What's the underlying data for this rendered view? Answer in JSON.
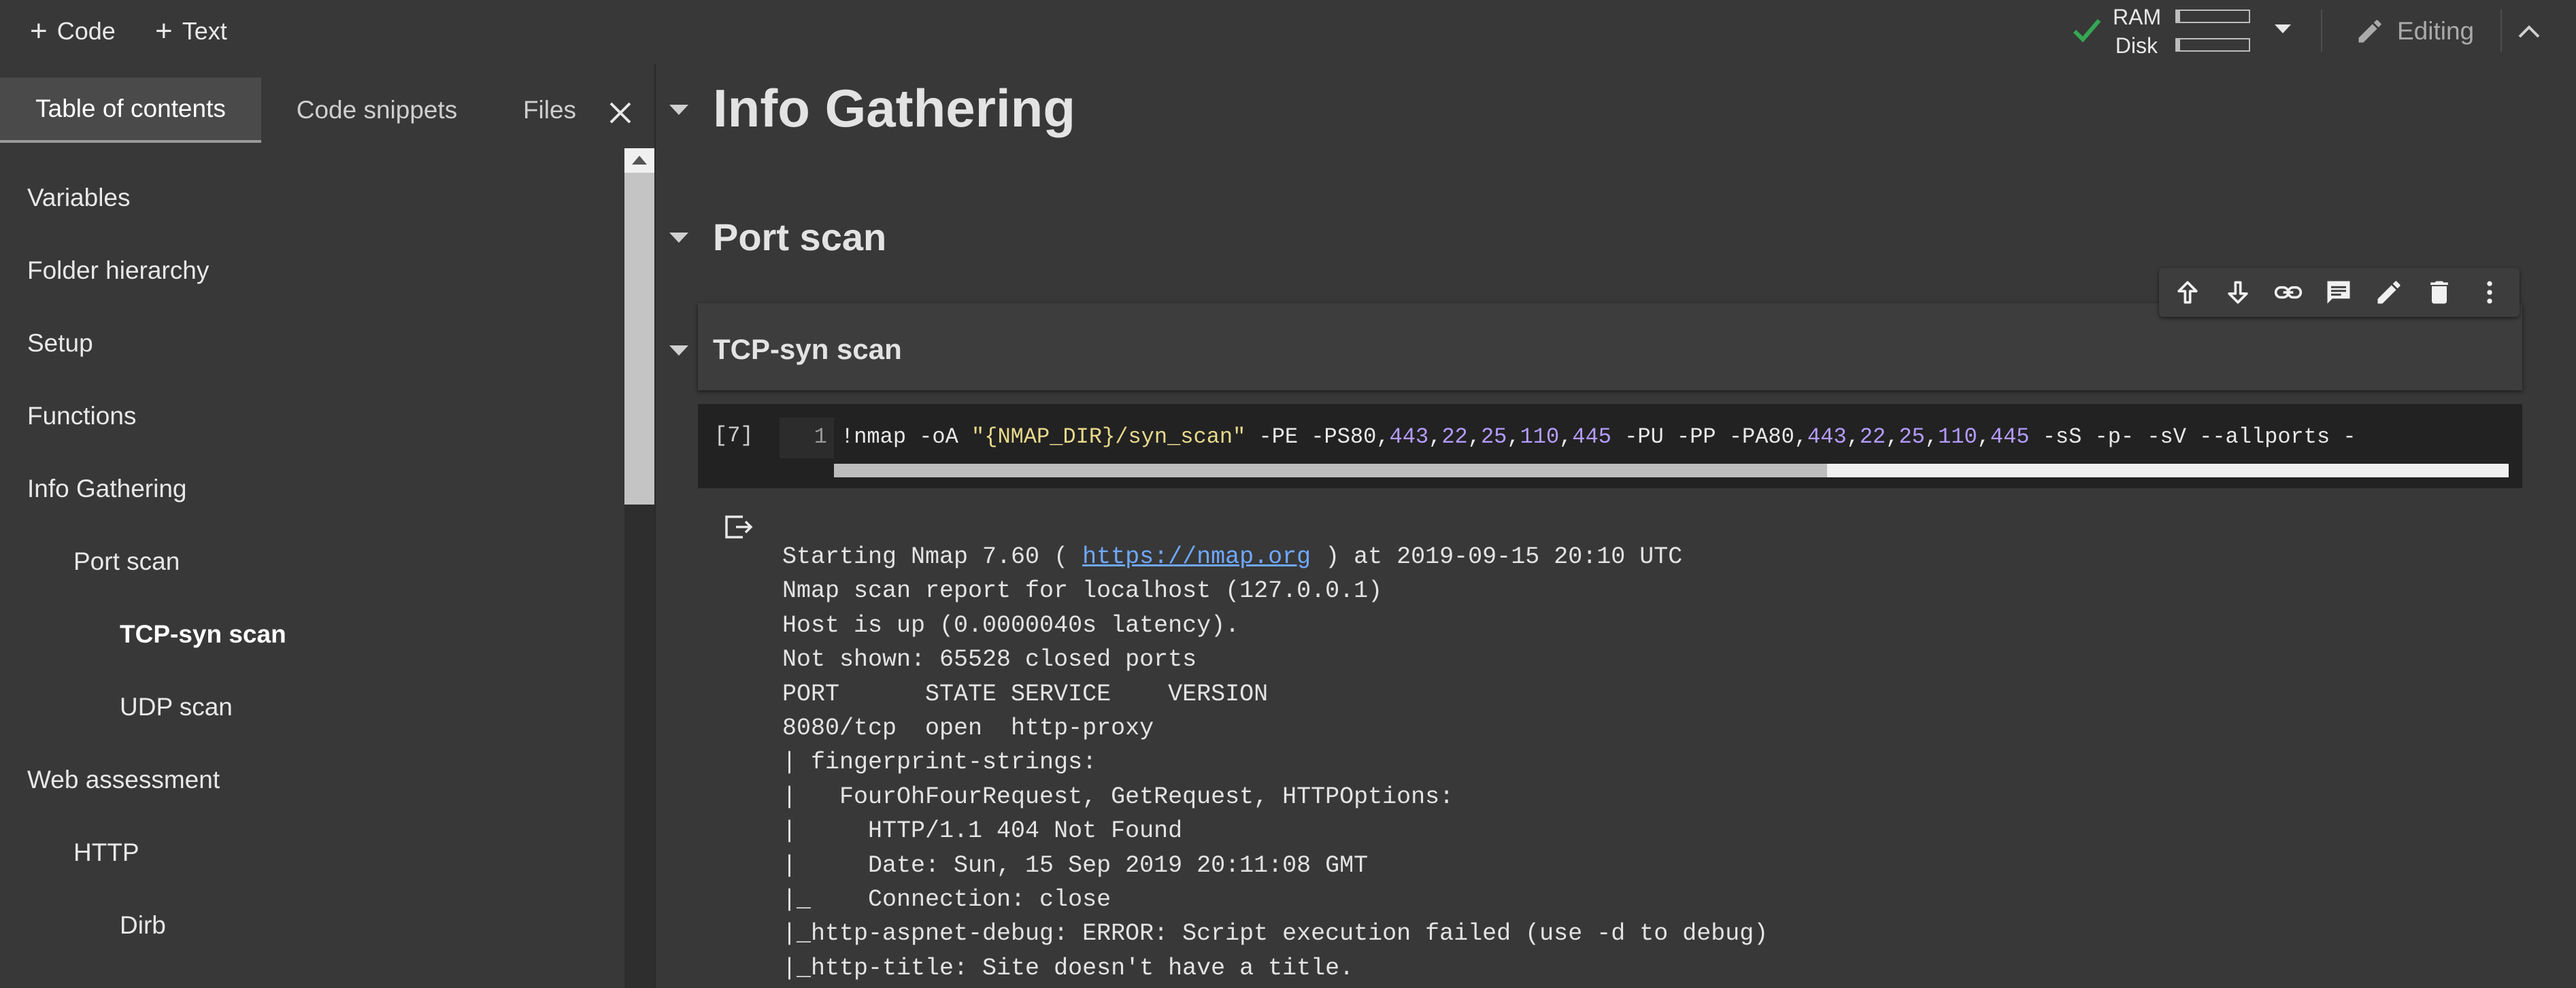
{
  "toolbar": {
    "add_code_label": "Code",
    "add_text_label": "Text",
    "ram_label": "RAM",
    "disk_label": "Disk",
    "ram_usage_fraction": 0.05,
    "disk_usage_fraction": 0.05,
    "editing_label": "Editing",
    "status_color": "#34a853"
  },
  "sidebar": {
    "tabs": [
      {
        "label": "Table of contents",
        "active": true
      },
      {
        "label": "Code snippets",
        "active": false
      },
      {
        "label": "Files",
        "active": false
      }
    ],
    "toc": [
      {
        "label": "Variables",
        "level": 0
      },
      {
        "label": "Folder hierarchy",
        "level": 0
      },
      {
        "label": "Setup",
        "level": 0
      },
      {
        "label": "Functions",
        "level": 0
      },
      {
        "label": "Info Gathering",
        "level": 0
      },
      {
        "label": "Port scan",
        "level": 1
      },
      {
        "label": "TCP-syn scan",
        "level": 2,
        "active": true
      },
      {
        "label": "UDP scan",
        "level": 2
      },
      {
        "label": "Web assessment",
        "level": 0
      },
      {
        "label": "HTTP",
        "level": 1
      },
      {
        "label": "Dirb",
        "level": 2
      }
    ]
  },
  "notebook": {
    "heading_info_gathering": "Info Gathering",
    "heading_port_scan": "Port scan",
    "heading_tcp_syn_scan": "TCP-syn scan",
    "cell_toolbar_icons": [
      "arrow-up-icon",
      "arrow-down-icon",
      "link-icon",
      "comment-icon",
      "edit-icon",
      "delete-icon",
      "more-vert-icon"
    ],
    "code_cell": {
      "exec_count": "[7]",
      "line_number": "1",
      "code_parts": {
        "p1": "!nmap -oA ",
        "s1": "\"{NMAP_DIR}/syn_scan\"",
        "p2": " -PE -PS80,",
        "n1": "443",
        "c1": ",",
        "n2": "22",
        "c2": ",",
        "n3": "25",
        "c3": ",",
        "n4": "110",
        "c4": ",",
        "n5": "445",
        "p3": " -PU -PP -PA80,",
        "n6": "443",
        "c5": ",",
        "n7": "22",
        "c6": ",",
        "n8": "25",
        "c7": ",",
        "n9": "110",
        "c8": ",",
        "n10": "445",
        "p4": " -sS -p- -sV --allports -"
      }
    },
    "output": {
      "line1_pre": "Starting Nmap 7.60 ( ",
      "line1_link": "https://nmap.org",
      "line1_post": " ) at 2019-09-15 20:10 UTC",
      "lines": [
        "Nmap scan report for localhost (127.0.0.1)",
        "Host is up (0.0000040s latency).",
        "Not shown: 65528 closed ports",
        "PORT      STATE SERVICE    VERSION",
        "8080/tcp  open  http-proxy",
        "| fingerprint-strings:",
        "|   FourOhFourRequest, GetRequest, HTTPOptions:",
        "|     HTTP/1.1 404 Not Found",
        "|     Date: Sun, 15 Sep 2019 20:11:08 GMT",
        "|_    Connection: close",
        "|_http-aspnet-debug: ERROR: Script execution failed (use -d to debug)",
        "|_http-title: Site doesn't have a title."
      ]
    }
  }
}
